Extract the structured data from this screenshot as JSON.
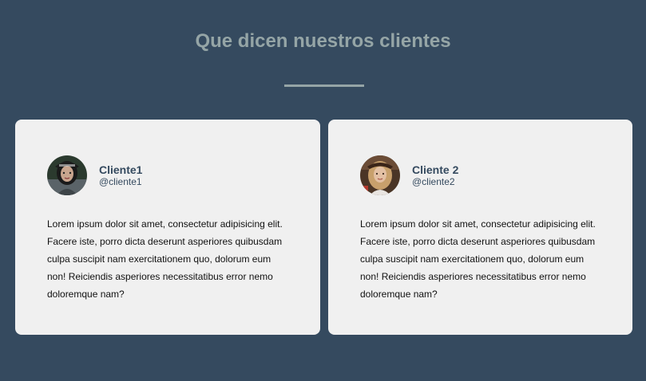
{
  "section": {
    "title": "Que dicen nuestros clientes"
  },
  "testimonials": [
    {
      "name": "Cliente1",
      "handle": "@cliente1",
      "avatar_icon": "avatar-photo-dark-hair",
      "text": "Lorem ipsum dolor sit amet, consectetur adipisicing elit. Facere iste, porro dicta deserunt asperiores quibusdam culpa suscipit nam exercitationem quo, dolorum eum non! Reiciendis asperiores necessitatibus error nemo doloremque nam?"
    },
    {
      "name": "Cliente 2",
      "handle": "@cliente2",
      "avatar_icon": "avatar-photo-blonde-hair",
      "text": "Lorem ipsum dolor sit amet, consectetur adipisicing elit. Facere iste, porro dicta deserunt asperiores quibusdam culpa suscipit nam exercitationem quo, dolorum eum non! Reiciendis asperiores necessitatibus error nemo doloremque nam?"
    }
  ],
  "colors": {
    "background": "#354a5f",
    "title": "#95a5a6",
    "card": "#f0f0f0",
    "name": "#354a5f"
  }
}
